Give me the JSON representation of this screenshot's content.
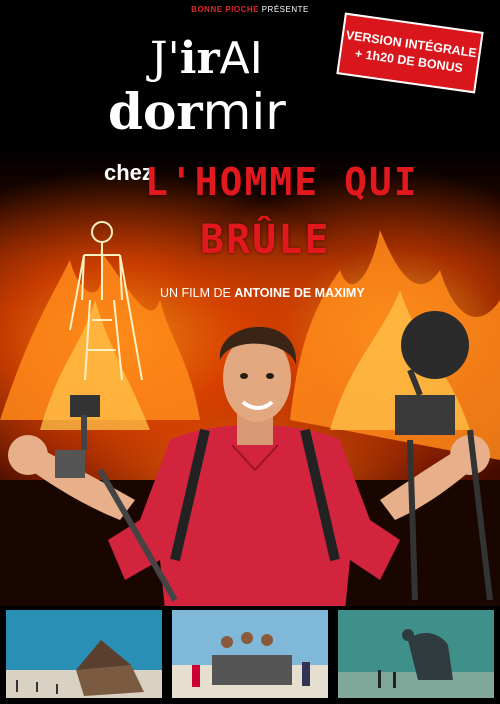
{
  "presenter": {
    "brand": "BONNE PIOCHE",
    "text": "PRÉSENTE"
  },
  "bonus_badge": {
    "line1": "VERSION INTÉGRALE",
    "line2": "+ 1h20 DE BONUS"
  },
  "title": {
    "line1_a": "J'",
    "line1_b": "ir",
    "line1_c": "AI",
    "line2_a": "dor",
    "line2_b": "mir",
    "chez": "chez",
    "red1": "L'HOMME QUI",
    "red2": "BRÛLE"
  },
  "credit": {
    "prefix": "UN FILM DE",
    "director": "ANTOINE DE MAXIMY"
  },
  "colors": {
    "accent_red": "#e2181d",
    "fire": "#ff7a10",
    "sky": "#2a8fb5"
  },
  "thumbnails": [
    "tilted-house-desert",
    "art-car-crowd",
    "sculpture-figure-desert"
  ]
}
